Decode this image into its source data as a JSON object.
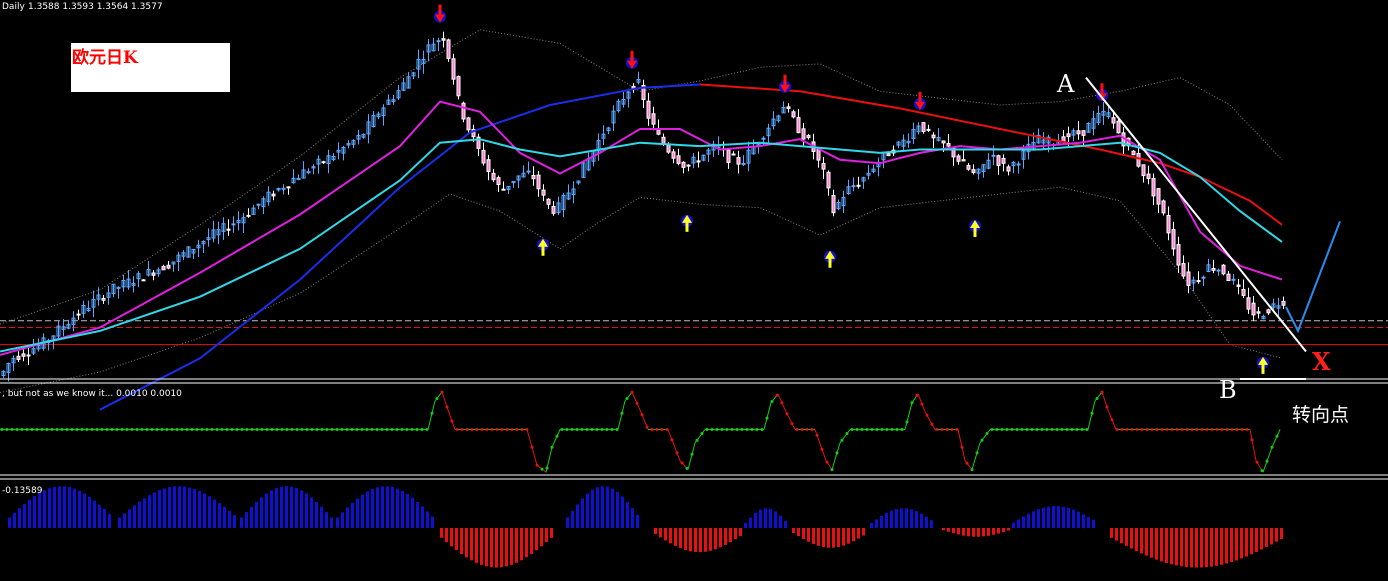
{
  "header": {
    "symbol_period": "Daily",
    "ohlc": "1.3588 1.3593 1.3564 1.3577"
  },
  "title_box": {
    "text": "欧元日K"
  },
  "annotations": {
    "point_a": "A",
    "point_b": "B",
    "target_x": "X",
    "turning_point": "转向点"
  },
  "indicator1": {
    "label": ", but not as we know it... 0.0010 0.0010"
  },
  "indicator2": {
    "label": "-0.13589"
  },
  "colors": {
    "background": "#000000",
    "bull_candle": "#5aa8ff",
    "bear_candle": "#ffffff",
    "ma_blue": "#1a2ee8",
    "ma_red": "#e81010",
    "ma_magenta": "#e020e0",
    "ma_cyan": "#30d8e8",
    "band": "#808080",
    "arrow_down": "#ff1010",
    "arrow_up": "#ffff20",
    "osc_up": "#10d010",
    "osc_down": "#e81010",
    "hist_pos": "#1010d0",
    "hist_neg": "#e81010",
    "projection": "#2a8cf0"
  },
  "chart_data": [
    {
      "type": "candlestick",
      "title": "欧元日K",
      "path": [
        [
          0,
          1.355
        ],
        [
          10,
          1.36
        ],
        [
          40,
          1.364
        ],
        [
          80,
          1.374
        ],
        [
          110,
          1.38
        ],
        [
          140,
          1.384
        ],
        [
          170,
          1.388
        ],
        [
          200,
          1.394
        ],
        [
          240,
          1.401
        ],
        [
          270,
          1.408
        ],
        [
          300,
          1.414
        ],
        [
          330,
          1.419
        ],
        [
          360,
          1.425
        ],
        [
          380,
          1.433
        ],
        [
          400,
          1.439
        ],
        [
          415,
          1.446
        ],
        [
          430,
          1.452
        ],
        [
          442,
          1.454
        ],
        [
          450,
          1.445
        ],
        [
          458,
          1.434
        ],
        [
          470,
          1.425
        ],
        [
          480,
          1.419
        ],
        [
          490,
          1.413
        ],
        [
          500,
          1.409
        ],
        [
          515,
          1.413
        ],
        [
          530,
          1.414
        ],
        [
          545,
          1.405
        ],
        [
          555,
          1.403
        ],
        [
          570,
          1.41
        ],
        [
          585,
          1.417
        ],
        [
          600,
          1.425
        ],
        [
          615,
          1.433
        ],
        [
          628,
          1.439
        ],
        [
          636,
          1.441
        ],
        [
          645,
          1.432
        ],
        [
          658,
          1.424
        ],
        [
          670,
          1.42
        ],
        [
          685,
          1.416
        ],
        [
          700,
          1.419
        ],
        [
          715,
          1.422
        ],
        [
          725,
          1.419
        ],
        [
          740,
          1.417
        ],
        [
          755,
          1.423
        ],
        [
          770,
          1.429
        ],
        [
          782,
          1.434
        ],
        [
          795,
          1.428
        ],
        [
          810,
          1.422
        ],
        [
          822,
          1.414
        ],
        [
          832,
          1.403
        ],
        [
          845,
          1.409
        ],
        [
          860,
          1.412
        ],
        [
          875,
          1.417
        ],
        [
          890,
          1.421
        ],
        [
          905,
          1.424
        ],
        [
          918,
          1.429
        ],
        [
          930,
          1.424
        ],
        [
          945,
          1.422
        ],
        [
          960,
          1.417
        ],
        [
          975,
          1.413
        ],
        [
          990,
          1.42
        ],
        [
          1005,
          1.415
        ],
        [
          1020,
          1.419
        ],
        [
          1035,
          1.424
        ],
        [
          1050,
          1.423
        ],
        [
          1065,
          1.425
        ],
        [
          1080,
          1.426
        ],
        [
          1095,
          1.43
        ],
        [
          1105,
          1.432
        ],
        [
          1115,
          1.427
        ],
        [
          1125,
          1.422
        ],
        [
          1135,
          1.418
        ],
        [
          1150,
          1.41
        ],
        [
          1163,
          1.401
        ],
        [
          1175,
          1.39
        ],
        [
          1185,
          1.382
        ],
        [
          1195,
          1.383
        ],
        [
          1208,
          1.387
        ],
        [
          1220,
          1.386
        ],
        [
          1232,
          1.382
        ],
        [
          1245,
          1.376
        ],
        [
          1255,
          1.372
        ],
        [
          1265,
          1.374
        ],
        [
          1275,
          1.376
        ],
        [
          1282,
          1.377
        ]
      ],
      "moving_averages": [
        {
          "color": "#1a2ee8",
          "points": [
            [
              100,
              1.345
            ],
            [
              200,
              1.36
            ],
            [
              300,
              1.383
            ],
            [
              400,
              1.41
            ],
            [
              470,
              1.426
            ],
            [
              550,
              1.434
            ],
            [
              640,
              1.439
            ],
            [
              700,
              1.44
            ]
          ]
        },
        {
          "color": "#e81010",
          "points": [
            [
              700,
              1.44
            ],
            [
              800,
              1.438
            ],
            [
              900,
              1.433
            ],
            [
              1000,
              1.427
            ],
            [
              1100,
              1.421
            ],
            [
              1160,
              1.417
            ],
            [
              1200,
              1.413
            ],
            [
              1250,
              1.406
            ],
            [
              1282,
              1.399
            ]
          ]
        },
        {
          "color": "#e020e0",
          "points": [
            [
              0,
              1.361
            ],
            [
              100,
              1.369
            ],
            [
              200,
              1.385
            ],
            [
              300,
              1.402
            ],
            [
              400,
              1.422
            ],
            [
              440,
              1.435
            ],
            [
              480,
              1.432
            ],
            [
              520,
              1.42
            ],
            [
              560,
              1.414
            ],
            [
              600,
              1.42
            ],
            [
              640,
              1.427
            ],
            [
              680,
              1.427
            ],
            [
              720,
              1.421
            ],
            [
              760,
              1.422
            ],
            [
              800,
              1.424
            ],
            [
              840,
              1.418
            ],
            [
              880,
              1.417
            ],
            [
              920,
              1.42
            ],
            [
              960,
              1.422
            ],
            [
              1000,
              1.421
            ],
            [
              1040,
              1.422
            ],
            [
              1080,
              1.423
            ],
            [
              1120,
              1.425
            ],
            [
              1160,
              1.418
            ],
            [
              1200,
              1.397
            ],
            [
              1240,
              1.387
            ],
            [
              1282,
              1.383
            ]
          ]
        },
        {
          "color": "#30d8e8",
          "points": [
            [
              0,
              1.362
            ],
            [
              100,
              1.368
            ],
            [
              200,
              1.378
            ],
            [
              300,
              1.392
            ],
            [
              400,
              1.412
            ],
            [
              440,
              1.423
            ],
            [
              480,
              1.424
            ],
            [
              520,
              1.421
            ],
            [
              560,
              1.419
            ],
            [
              600,
              1.421
            ],
            [
              640,
              1.423
            ],
            [
              700,
              1.422
            ],
            [
              760,
              1.423
            ],
            [
              800,
              1.422
            ],
            [
              840,
              1.421
            ],
            [
              880,
              1.42
            ],
            [
              920,
              1.421
            ],
            [
              960,
              1.421
            ],
            [
              1000,
              1.421
            ],
            [
              1040,
              1.421
            ],
            [
              1080,
              1.422
            ],
            [
              1120,
              1.423
            ],
            [
              1160,
              1.42
            ],
            [
              1200,
              1.413
            ],
            [
              1240,
              1.403
            ],
            [
              1282,
              1.394
            ]
          ]
        }
      ],
      "bands": [
        {
          "color": "#808080",
          "points": [
            [
              0,
              1.37
            ],
            [
              100,
              1.38
            ],
            [
              200,
              1.399
            ],
            [
              300,
              1.419
            ],
            [
              400,
              1.442
            ],
            [
              480,
              1.456
            ],
            [
              560,
              1.452
            ],
            [
              600,
              1.445
            ],
            [
              640,
              1.438
            ],
            [
              700,
              1.441
            ],
            [
              760,
              1.445
            ],
            [
              820,
              1.446
            ],
            [
              880,
              1.438
            ],
            [
              940,
              1.436
            ],
            [
              1000,
              1.434
            ],
            [
              1060,
              1.435
            ],
            [
              1120,
              1.438
            ],
            [
              1180,
              1.442
            ],
            [
              1230,
              1.434
            ],
            [
              1282,
              1.418
            ]
          ]
        },
        {
          "color": "#808080",
          "points": [
            [
              0,
              1.35
            ],
            [
              100,
              1.356
            ],
            [
              200,
              1.366
            ],
            [
              300,
              1.379
            ],
            [
              400,
              1.398
            ],
            [
              450,
              1.408
            ],
            [
              500,
              1.403
            ],
            [
              560,
              1.392
            ],
            [
              600,
              1.4
            ],
            [
              640,
              1.407
            ],
            [
              700,
              1.405
            ],
            [
              760,
              1.404
            ],
            [
              820,
              1.396
            ],
            [
              880,
              1.404
            ],
            [
              940,
              1.406
            ],
            [
              1000,
              1.408
            ],
            [
              1060,
              1.41
            ],
            [
              1120,
              1.406
            ],
            [
              1180,
              1.385
            ],
            [
              1230,
              1.364
            ],
            [
              1282,
              1.36
            ]
          ]
        }
      ],
      "signals": [
        {
          "kind": "down",
          "x": 440,
          "price": 1.4575
        },
        {
          "kind": "down",
          "x": 632,
          "price": 1.444
        },
        {
          "kind": "down",
          "x": 785,
          "price": 1.437
        },
        {
          "kind": "down",
          "x": 920,
          "price": 1.432
        },
        {
          "kind": "down",
          "x": 1102,
          "price": 1.4345
        },
        {
          "kind": "up",
          "x": 543,
          "price": 1.3955
        },
        {
          "kind": "up",
          "x": 687,
          "price": 1.4025
        },
        {
          "kind": "up",
          "x": 830,
          "price": 1.392
        },
        {
          "kind": "up",
          "x": 975,
          "price": 1.401
        },
        {
          "kind": "up",
          "x": 1263,
          "price": 1.361
        }
      ],
      "trendline": [
        [
          1086,
          1.442
        ],
        [
          1306,
          1.362
        ]
      ],
      "support_lines": [
        1.371,
        1.369,
        1.364
      ],
      "projection": [
        [
          1286,
          1.375
        ],
        [
          1298,
          1.368
        ],
        [
          1340,
          1.4
        ]
      ]
    },
    {
      "type": "line",
      "name": "indicator1",
      "ylim": [
        0,
        1
      ],
      "points": [
        [
          0,
          0.5
        ],
        [
          428,
          0.5
        ],
        [
          435,
          0.82
        ],
        [
          442,
          0.92
        ],
        [
          448,
          0.72
        ],
        [
          455,
          0.5
        ],
        [
          527,
          0.5
        ],
        [
          537,
          0.1
        ],
        [
          546,
          0.02
        ],
        [
          552,
          0.3
        ],
        [
          560,
          0.5
        ],
        [
          618,
          0.5
        ],
        [
          625,
          0.82
        ],
        [
          632,
          0.92
        ],
        [
          640,
          0.72
        ],
        [
          648,
          0.5
        ],
        [
          668,
          0.5
        ],
        [
          680,
          0.15
        ],
        [
          688,
          0.05
        ],
        [
          695,
          0.35
        ],
        [
          705,
          0.5
        ],
        [
          764,
          0.5
        ],
        [
          771,
          0.8
        ],
        [
          778,
          0.9
        ],
        [
          786,
          0.7
        ],
        [
          795,
          0.5
        ],
        [
          815,
          0.5
        ],
        [
          826,
          0.15
        ],
        [
          832,
          0.05
        ],
        [
          840,
          0.35
        ],
        [
          850,
          0.5
        ],
        [
          905,
          0.5
        ],
        [
          912,
          0.8
        ],
        [
          918,
          0.9
        ],
        [
          925,
          0.7
        ],
        [
          935,
          0.5
        ],
        [
          958,
          0.5
        ],
        [
          965,
          0.15
        ],
        [
          972,
          0.05
        ],
        [
          980,
          0.35
        ],
        [
          990,
          0.5
        ],
        [
          1088,
          0.5
        ],
        [
          1095,
          0.82
        ],
        [
          1102,
          0.92
        ],
        [
          1108,
          0.72
        ],
        [
          1116,
          0.5
        ],
        [
          1250,
          0.5
        ],
        [
          1256,
          0.15
        ],
        [
          1263,
          0.02
        ],
        [
          1272,
          0.3
        ],
        [
          1280,
          0.5
        ]
      ]
    },
    {
      "type": "bar",
      "name": "indicator2",
      "segments": [
        {
          "start": 8,
          "end": 112,
          "peak": 0.95
        },
        {
          "start": 118,
          "end": 236,
          "peak": 0.95
        },
        {
          "start": 240,
          "end": 330,
          "peak": 0.95
        },
        {
          "start": 336,
          "end": 432,
          "peak": 0.95
        },
        {
          "start": 440,
          "end": 550,
          "peak": -0.9
        },
        {
          "start": 566,
          "end": 638,
          "peak": 0.95
        },
        {
          "start": 654,
          "end": 742,
          "peak": -0.55
        },
        {
          "start": 744,
          "end": 786,
          "peak": 0.45
        },
        {
          "start": 792,
          "end": 866,
          "peak": -0.45
        },
        {
          "start": 870,
          "end": 934,
          "peak": 0.45
        },
        {
          "start": 942,
          "end": 1008,
          "peak": -0.2
        },
        {
          "start": 1012,
          "end": 1096,
          "peak": 0.5
        },
        {
          "start": 1110,
          "end": 1282,
          "peak": -0.9
        }
      ]
    }
  ]
}
